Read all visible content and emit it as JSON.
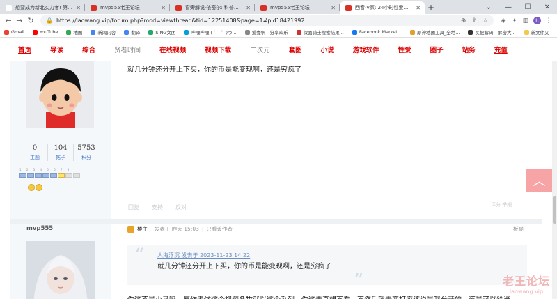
{
  "browser": {
    "tabs": [
      {
        "title": "想要成为新北实力者! 第二季·",
        "color": "#ffffff",
        "active": false
      },
      {
        "title": "mvp555老王论坛",
        "color": "#d93025",
        "active": false
      },
      {
        "title": "窗旁解说·依密尔: 科普民事援",
        "color": "#d93025",
        "active": false
      },
      {
        "title": "mvp555老王论坛",
        "color": "#d93025",
        "active": false
      },
      {
        "title": "回音·V家: 24小时性爱耐力赛",
        "color": "#d93025",
        "active": true
      }
    ],
    "new_tab": "+",
    "url": "https://laowang.vip/forum.php?mod=viewthread&tid=12251408&page=1#pid18421992",
    "profile_initial": "h"
  },
  "bookmarks": [
    {
      "label": "Gmail",
      "color": "#ea4335"
    },
    {
      "label": "YouTube",
      "color": "#ff0000"
    },
    {
      "label": "地图",
      "color": "#34a853"
    },
    {
      "label": "新闻内容",
      "color": "#4285f4"
    },
    {
      "label": "翻译",
      "color": "#4285f4"
    },
    {
      "label": "SING女团",
      "color": "#22aa66"
    },
    {
      "label": "哔哩哔哩 ( ゜- ゜)つ...",
      "color": "#00a1d6"
    },
    {
      "label": "爱壹帆 - 分享欢乐",
      "color": "#888888"
    },
    {
      "label": "假面骑士搜索结果...",
      "color": "#cc3333"
    },
    {
      "label": "Facebook Market...",
      "color": "#1877f2"
    },
    {
      "label": "原神地图工具_全地...",
      "color": "#e0a030"
    },
    {
      "label": "买被解码 - 解密大...",
      "color": "#333333"
    },
    {
      "label": "新文件夹",
      "color": "#f2c94c"
    }
  ],
  "site_nav": [
    {
      "label": "首页",
      "style": "active"
    },
    {
      "label": "导读",
      "style": "red"
    },
    {
      "label": "综合",
      "style": "red"
    },
    {
      "label": "贤者时间",
      "style": "plain"
    },
    {
      "label": "在线视频",
      "style": "red"
    },
    {
      "label": "视频下载",
      "style": "red"
    },
    {
      "label": "二次元",
      "style": "plain"
    },
    {
      "label": "套图",
      "style": "red"
    },
    {
      "label": "小说",
      "style": "red"
    },
    {
      "label": "游戏软件",
      "style": "red"
    },
    {
      "label": "性爱",
      "style": "red"
    },
    {
      "label": "圈子",
      "style": "red"
    },
    {
      "label": "站务",
      "style": "red"
    },
    {
      "label": "充值",
      "style": "active"
    }
  ],
  "post1": {
    "stats": [
      {
        "num": "0",
        "label": "主题"
      },
      {
        "num": "104",
        "label": "帖子"
      },
      {
        "num": "5753",
        "label": "积分"
      }
    ],
    "level_numbers": "1 2 3 4 5 6 7 8",
    "text": "就几分钟还分开上下买，你的币是能变现啊，还是穷疯了",
    "actions": [
      "回复",
      "支持",
      "反对"
    ],
    "right_actions": "评分    举报"
  },
  "post2": {
    "author": "mvp555",
    "louzhu": "楼主",
    "posted": "发表于 昨天 15:03",
    "only_author": "只看该作者",
    "floor": "板凳",
    "quote_head": "人海浮沉 发表于 2023-11-23 14:22",
    "quote_text": "就几分钟还分开上下买，你的币是能变现啊，还是穷疯了",
    "text": "你这不是小马吗，原作者做这个视频多牧就以这个系列，你这去真想不看，不然后就去变打应该说是我分开的，还是可以给当"
  },
  "back_to_top": "︿",
  "watermark": {
    "line1": "老王论坛",
    "line2": "laowang.vip"
  }
}
